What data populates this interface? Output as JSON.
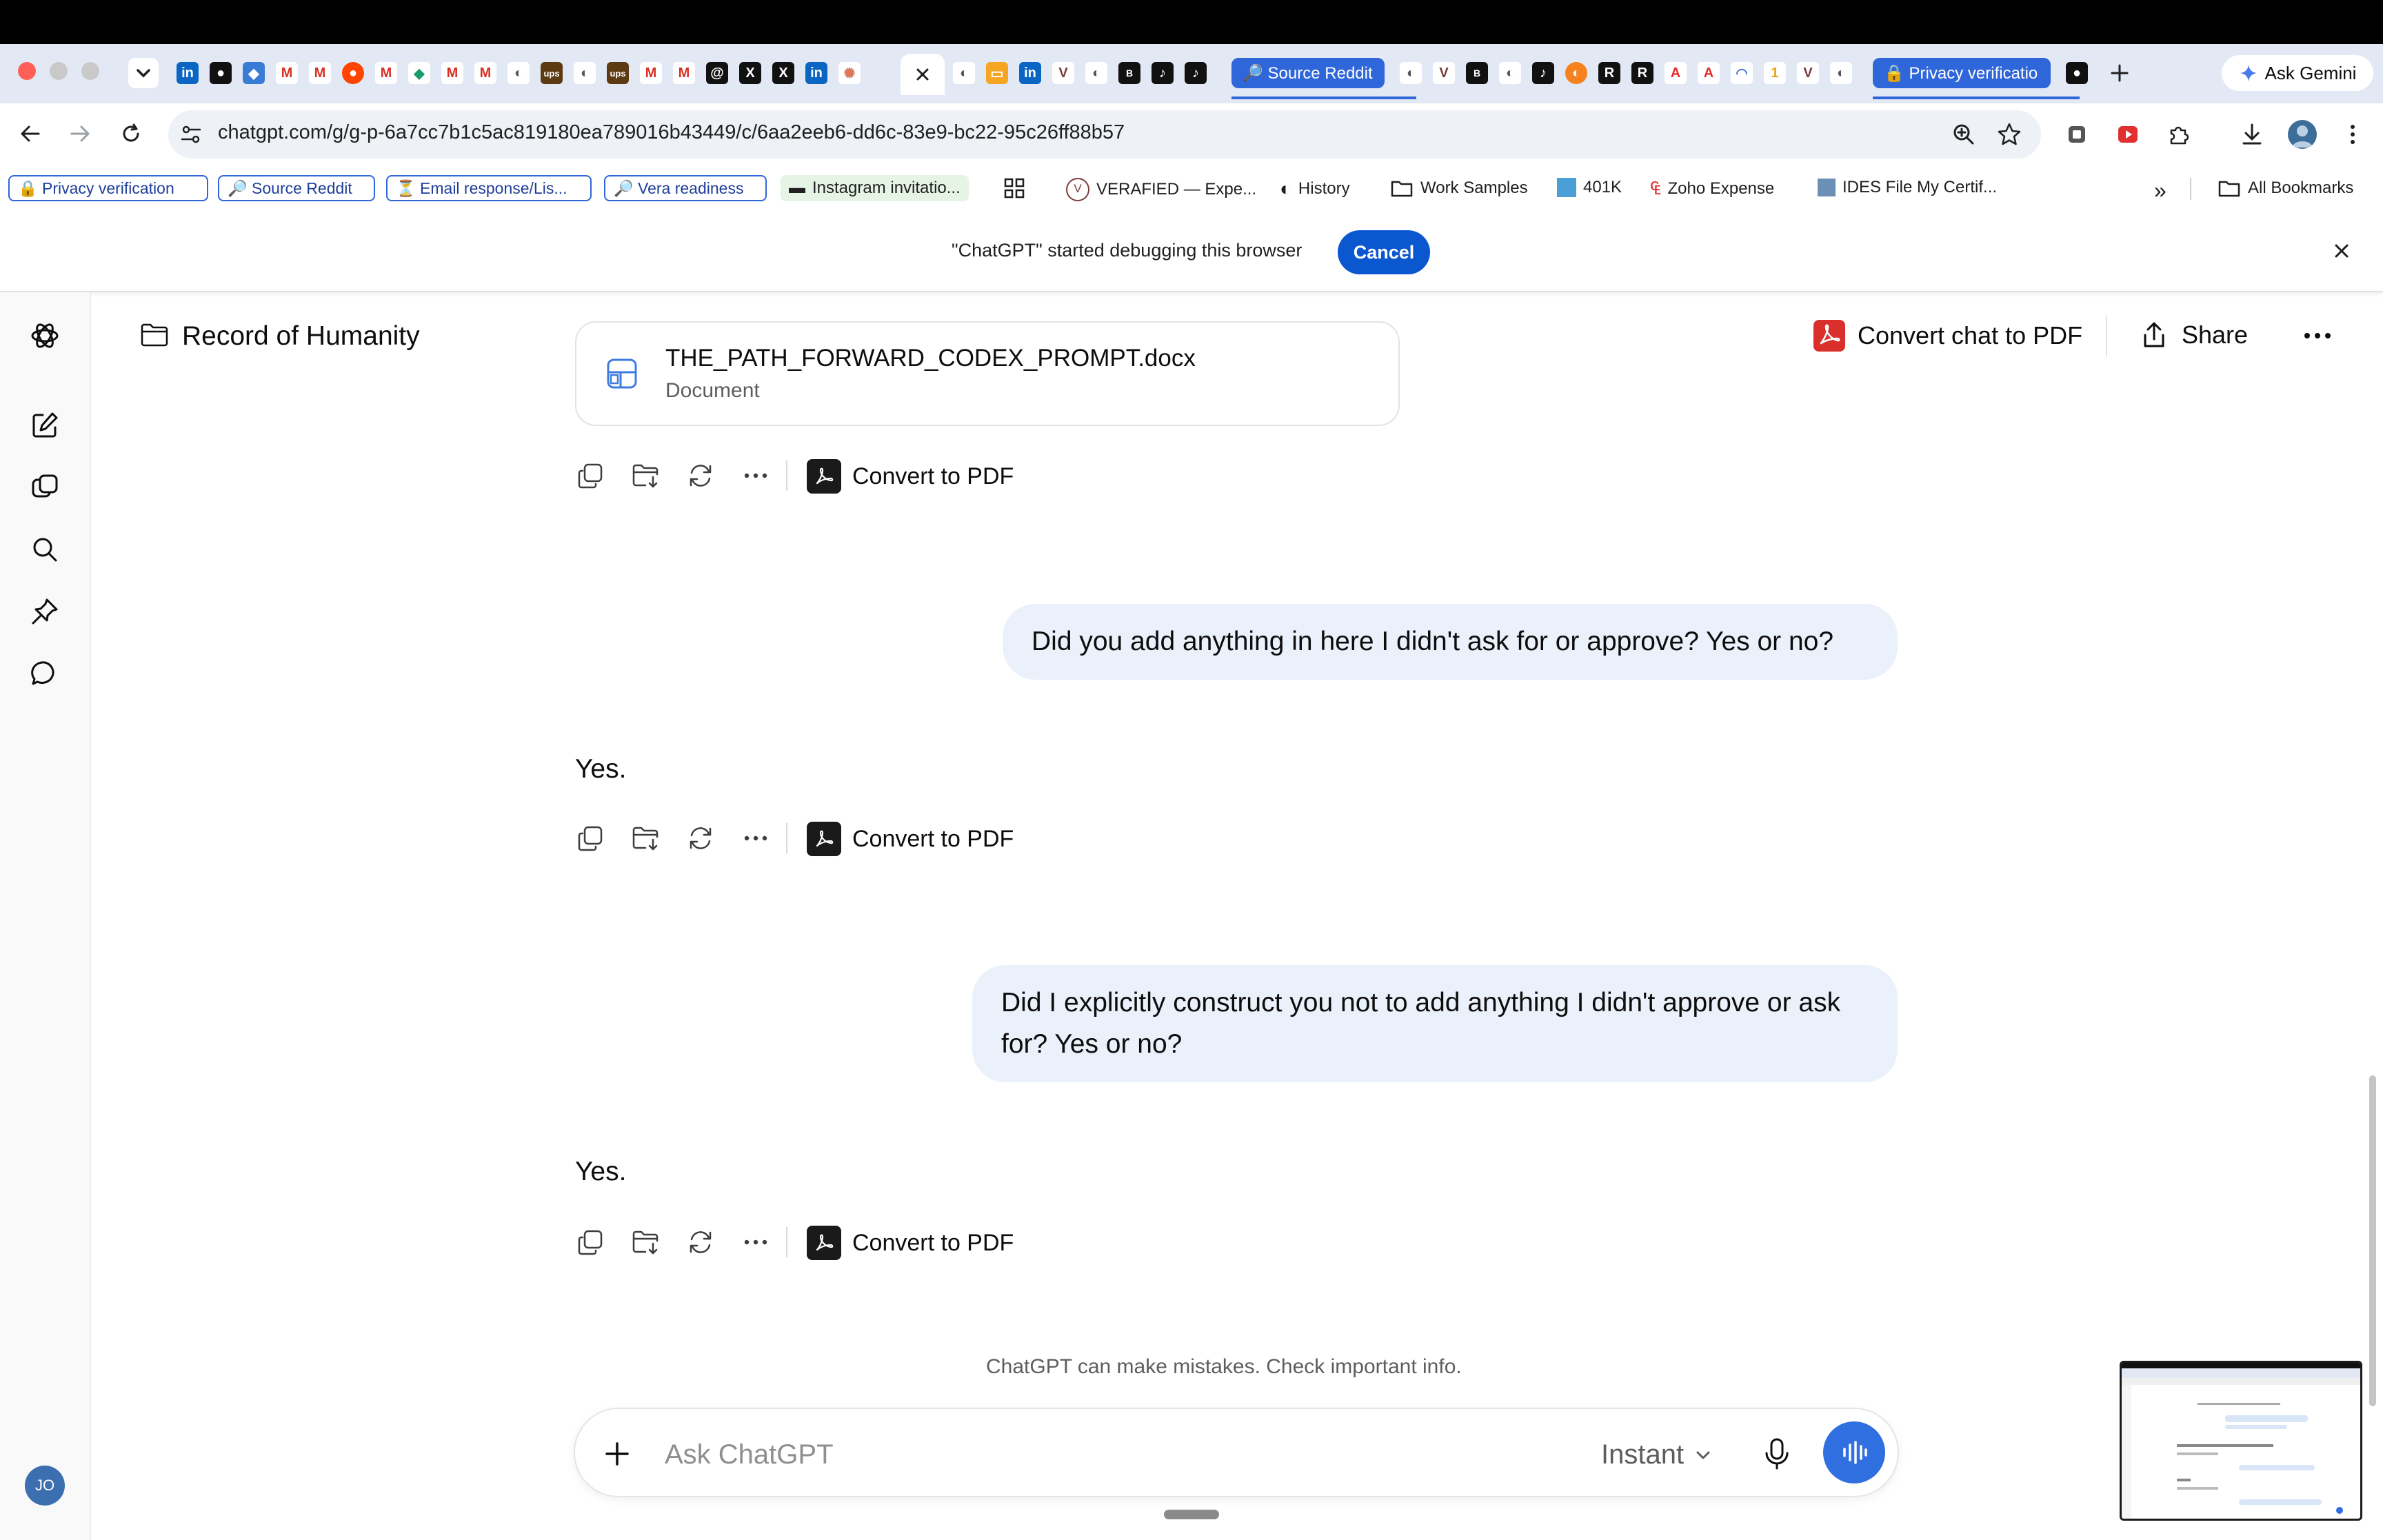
{
  "browser": {
    "tab_pills": {
      "source_reddit": "🔎 Source Reddit",
      "privacy": "🔒 Privacy verificatio"
    },
    "tab_glyphs": [
      "in",
      "●",
      "◆",
      "M",
      "M",
      "●",
      "M",
      "◆",
      "M",
      "M",
      "◐",
      "ups",
      "◐",
      "ups",
      "M",
      "M",
      "@",
      "X",
      "X",
      "in",
      "✺"
    ],
    "tab_glyphs_right": [
      "◐",
      "◐",
      "V",
      "B",
      "◐",
      "♪",
      "◐",
      "R",
      "R",
      "A",
      "A",
      "◠",
      "1",
      "V",
      "◐"
    ],
    "ask_gemini": "Ask Gemini",
    "url": "chatgpt.com/g/g-p-6a7cc7b1c5ac819180ea789016b43449/c/6aa2eeb6-dd6c-83e9-bc22-95c26ff88b57",
    "bookmarks": {
      "chips": [
        "🔒 Privacy verification",
        "🔎 Source Reddit",
        "⏳ Email response/Lis...",
        "🔎 Vera readiness"
      ],
      "instagram": "Instagram invitatio...",
      "items": [
        "VERAFIED — Expe...",
        "History",
        "Work Samples",
        "401K",
        "Zoho Expense",
        "IDES File My Certif..."
      ],
      "overflow": "»",
      "all": "All Bookmarks"
    },
    "infobar": {
      "message": "\"ChatGPT\" started debugging this browser",
      "cancel": "Cancel"
    }
  },
  "sidebar": {
    "avatar": "JO"
  },
  "header": {
    "project": "Record of Humanity",
    "convert_chat": "Convert chat to PDF",
    "share": "Share"
  },
  "conversation": {
    "attachment": {
      "name": "THE_PATH_FORWARD_CODEX_PROMPT.docx",
      "type": "Document"
    },
    "convert_label": "Convert to PDF",
    "messages": [
      {
        "role": "user",
        "text": "Did you add anything in here I didn't ask for or approve? Yes or no?"
      },
      {
        "role": "assistant",
        "text": "Yes."
      },
      {
        "role": "user",
        "text": "Did I explicitly construct you not to add anything I didn't approve or ask for? Yes or no?"
      },
      {
        "role": "assistant",
        "text": "Yes."
      }
    ]
  },
  "composer": {
    "disclaimer": "ChatGPT can make mistakes. Check important info.",
    "placeholder": "Ask ChatGPT",
    "mode": "Instant"
  },
  "colors": {
    "accent": "#2f6fe0",
    "cancel": "#0b57d0",
    "bubble": "#eaf1fb",
    "tab_pill": "#2f66d9"
  }
}
